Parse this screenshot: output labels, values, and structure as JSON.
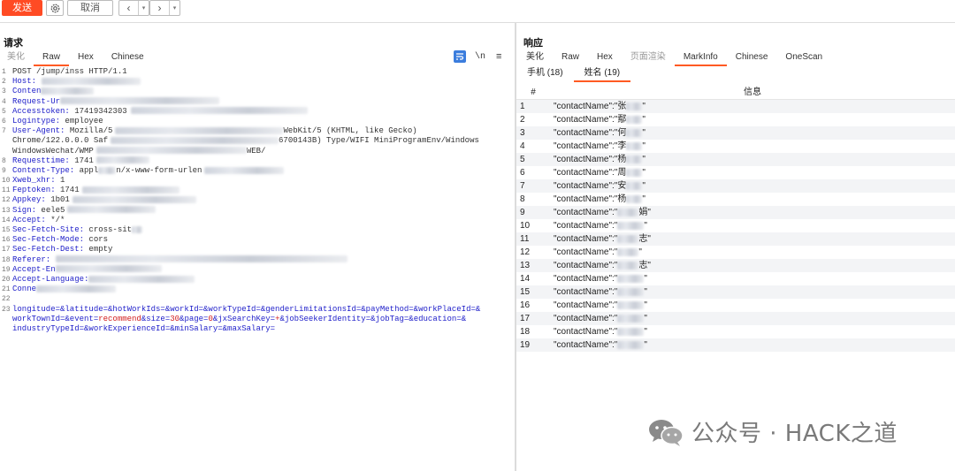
{
  "toolbar": {
    "send_label": "发送",
    "cancel_label": "取消",
    "back_icon": "‹",
    "forward_icon": "›",
    "caret_icon": "▾"
  },
  "request": {
    "title": "请求",
    "tabs": [
      "美化",
      "Raw",
      "Hex",
      "Chinese"
    ],
    "active_tab": "Raw",
    "newline_label": "\\n",
    "menu_icon": "≡",
    "lines": [
      {
        "n": "1",
        "h": "POST /jump/inss HTTP/1.1",
        "v": ""
      },
      {
        "n": "2",
        "h": "Host:",
        "v": " "
      },
      {
        "n": "3",
        "h": "Conten",
        "v": ""
      },
      {
        "n": "4",
        "h": "Request-Ur",
        "v": ""
      },
      {
        "n": "5",
        "h": "Accesstoken:",
        "v": " 17419342303"
      },
      {
        "n": "6",
        "h": "Logintype:",
        "v": " employee"
      },
      {
        "n": "7",
        "h": "User-Agent:",
        "v": " Mozilla/5"
      },
      {
        "n": "",
        "h": "",
        "v": "Chrome/122.0.0.0 Saf"
      },
      {
        "n": "",
        "h": "",
        "v": "WindowsWechat/WMP"
      },
      {
        "n": "8",
        "h": "Requesttime:",
        "v": " 1741"
      },
      {
        "n": "9",
        "h": "Content-Type:",
        "v": " appl"
      },
      {
        "n": "10",
        "h": "Xweb_xhr:",
        "v": " 1"
      },
      {
        "n": "11",
        "h": "Feptoken:",
        "v": " 1741"
      },
      {
        "n": "12",
        "h": "Appkey:",
        "v": " 1b01"
      },
      {
        "n": "13",
        "h": "Sign:",
        "v": " eele5"
      },
      {
        "n": "14",
        "h": "Accept:",
        "v": " */*"
      },
      {
        "n": "15",
        "h": "Sec-Fetch-Site:",
        "v": " cross-sit"
      },
      {
        "n": "16",
        "h": "Sec-Fetch-Mode:",
        "v": " cors"
      },
      {
        "n": "17",
        "h": "Sec-Fetch-Dest:",
        "v": " empty"
      },
      {
        "n": "18",
        "h": "Referer:",
        "v": ""
      },
      {
        "n": "19",
        "h": "Accept-En",
        "v": ""
      },
      {
        "n": "20",
        "h": "Accept-Language:",
        "v": ""
      },
      {
        "n": "21",
        "h": "Conne",
        "v": ""
      },
      {
        "n": "22",
        "h": "",
        "v": ""
      },
      {
        "n": "23",
        "h": "",
        "v": ""
      }
    ],
    "ua_line1_tail": "WebKit/5  (KHTML, like Gecko)",
    "ua_line2_tail": "6700143B)  Type/WIFI MiniProgramEnv/Windows",
    "ua_line3_tail": "WEB/",
    "content_type_tail": "n/x-www-form-urlen",
    "body_line1": "longitude=&latitude=&hotWorkIds=&workId=&workTypeId=&genderLimitationsId=&payMethod=&workPlaceId=&",
    "body_line2_a": "workTownId=&event=",
    "body_line2_red1": "recommend",
    "body_line2_b": "&size=",
    "body_line2_red2": "30",
    "body_line2_c": "&page=",
    "body_line2_red3": "0",
    "body_line2_d": "&jxSearchKey=",
    "body_line2_red4": "+",
    "body_line2_e": "&jobSeekerIdentity=&jobTag=&education=&",
    "body_line3": "industryTypeId=&workExperienceId=&minSalary=&maxSalary="
  },
  "response": {
    "title": "响应",
    "tabs": [
      "美化",
      "Raw",
      "Hex",
      "页面渲染",
      "MarkInfo",
      "Chinese",
      "OneScan"
    ],
    "active_tab": "MarkInfo",
    "subtabs": [
      "手机 (18)",
      "姓名 (19)"
    ],
    "active_subtab": "姓名 (19)",
    "table": {
      "col_num": "#",
      "col_info": "信息",
      "rows": [
        {
          "n": "1",
          "text": "\"contactName\":\"张",
          "end": "\""
        },
        {
          "n": "2",
          "text": "\"contactName\":\"鄢",
          "end": "\""
        },
        {
          "n": "3",
          "text": "\"contactName\":\"何",
          "end": "\""
        },
        {
          "n": "4",
          "text": "\"contactName\":\"李",
          "end": "\""
        },
        {
          "n": "5",
          "text": "\"contactName\":\"杨",
          "end": "\""
        },
        {
          "n": "6",
          "text": "\"contactName\":\"周",
          "end": "\""
        },
        {
          "n": "7",
          "text": "\"contactName\":\"安",
          "end": "\""
        },
        {
          "n": "8",
          "text": "\"contactName\":\"杨",
          "end": "\""
        },
        {
          "n": "9",
          "text": "\"contactName\":\"",
          "end": "娟\""
        },
        {
          "n": "10",
          "text": "\"contactName\":\"",
          "end": "\""
        },
        {
          "n": "11",
          "text": "\"contactName\":\"",
          "end": "志\""
        },
        {
          "n": "12",
          "text": "\"contactName\":\"",
          "end": "\""
        },
        {
          "n": "13",
          "text": "\"contactName\":\"",
          "end": "志\""
        },
        {
          "n": "14",
          "text": "\"contactName\":\"",
          "end": "\""
        },
        {
          "n": "15",
          "text": "\"contactName\":\"",
          "end": "\""
        },
        {
          "n": "16",
          "text": "\"contactName\":\"",
          "end": "\""
        },
        {
          "n": "17",
          "text": "\"contactName\":\"",
          "end": "\""
        },
        {
          "n": "18",
          "text": "\"contactName\":\"",
          "end": "\""
        },
        {
          "n": "19",
          "text": "\"contactName\":\"",
          "end": "\""
        }
      ]
    }
  },
  "watermark": {
    "text": "公众号 · HACK之道"
  },
  "colors": {
    "accent": "#ff5a23",
    "send": "#ff4b24",
    "header_key": "#1d1dc9",
    "param_red": "#d11b1b"
  }
}
